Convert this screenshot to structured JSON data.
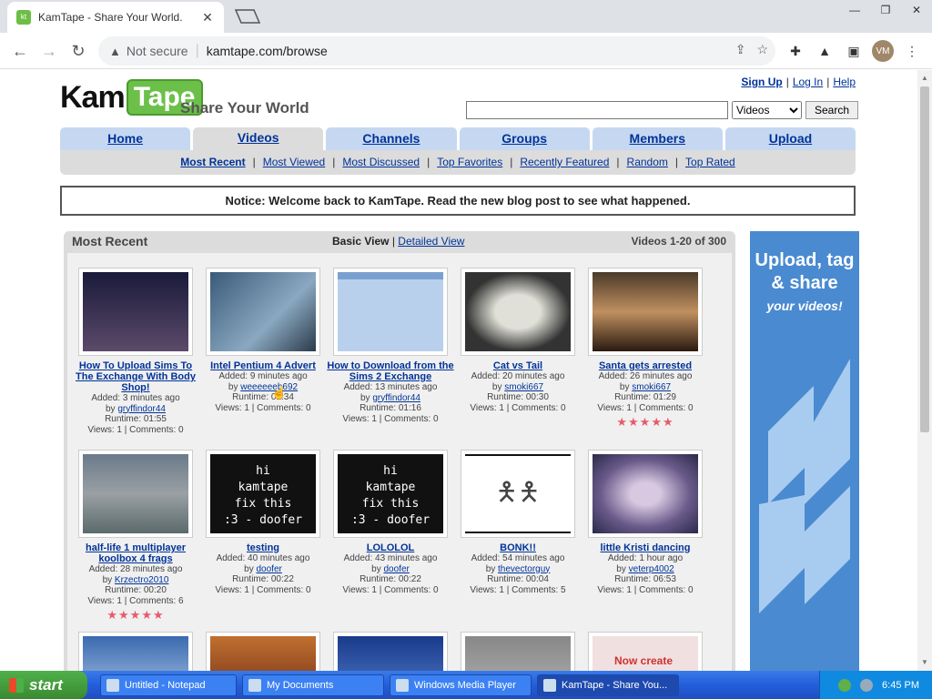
{
  "browser": {
    "tab_title": "KamTape - Share Your World.",
    "tab_favicon_text": "kt",
    "security_label": "Not secure",
    "url": "kamtape.com/browse",
    "profile_initials": "VM"
  },
  "header": {
    "logo_kam": "Kam",
    "logo_tape": "Tape",
    "slogan": "Share Your World",
    "signup": "Sign Up",
    "login": "Log In",
    "help": "Help",
    "sep": "|",
    "search_value": "",
    "search_option": "Videos",
    "search_button": "Search"
  },
  "nav": {
    "tabs": [
      "Home",
      "Videos",
      "Channels",
      "Groups",
      "Members",
      "Upload"
    ],
    "active": "Videos",
    "sub": [
      "Most Recent",
      "Most Viewed",
      "Most Discussed",
      "Top Favorites",
      "Recently Featured",
      "Random",
      "Top Rated"
    ]
  },
  "notice": "Notice: Welcome back to KamTape. Read the new blog post to see what happened.",
  "panel": {
    "title": "Most Recent",
    "basic_view": "Basic View",
    "pipe": "|",
    "detailed_view": "Detailed View",
    "count": "Videos 1-20 of 300"
  },
  "videos": [
    {
      "title": "How To Upload Sims To The Exchange With Body Shop!",
      "added": "Added: 3 minutes ago",
      "by": "by",
      "user": "gryffindor44",
      "runtime": "Runtime: 01:55",
      "stats": "Views: 1 | Comments: 0",
      "stars": ""
    },
    {
      "title": "Intel Pentium 4 Advert",
      "added": "Added: 9 minutes ago",
      "by": "by",
      "user": "weeeeeeb692",
      "runtime": "Runtime: 01:34",
      "stats": "Views: 1 | Comments: 0",
      "stars": ""
    },
    {
      "title": "How to Download from the Sims 2 Exchange",
      "added": "Added: 13 minutes ago",
      "by": "by",
      "user": "gryffindor44",
      "runtime": "Runtime: 01:16",
      "stats": "Views: 1 | Comments: 0",
      "stars": ""
    },
    {
      "title": "Cat vs Tail",
      "added": "Added: 20 minutes ago",
      "by": "by",
      "user": "smoki667",
      "runtime": "Runtime: 00:30",
      "stats": "Views: 1 | Comments: 0",
      "stars": ""
    },
    {
      "title": "Santa gets arrested",
      "added": "Added: 26 minutes ago",
      "by": "by",
      "user": "smoki667",
      "runtime": "Runtime: 01:29",
      "stats": "Views: 1 | Comments: 0",
      "stars": "★★★★★"
    },
    {
      "title": "half-life 1 multiplayer koolbox 4 frags",
      "added": "Added: 28 minutes ago",
      "by": "by",
      "user": "Krzectro2010",
      "runtime": "Runtime: 00:20",
      "stats": "Views: 1 | Comments: 6",
      "stars": "★★★★★"
    },
    {
      "title": "testing",
      "added": "Added: 40 minutes ago",
      "by": "by",
      "user": "doofer",
      "runtime": "Runtime: 00:22",
      "stats": "Views: 1 | Comments: 0",
      "stars": ""
    },
    {
      "title": "LOLOLOL",
      "added": "Added: 43 minutes ago",
      "by": "by",
      "user": "doofer",
      "runtime": "Runtime: 00:22",
      "stats": "Views: 1 | Comments: 0",
      "stars": ""
    },
    {
      "title": "BONK!!",
      "added": "Added: 54 minutes ago",
      "by": "by",
      "user": "thevectorguy",
      "runtime": "Runtime: 00:04",
      "stats": "Views: 1 | Comments: 5",
      "stars": ""
    },
    {
      "title": "little Kristi dancing",
      "added": "Added: 1 hour ago",
      "by": "by",
      "user": "veterp4002",
      "runtime": "Runtime: 06:53",
      "stats": "Views: 1 | Comments: 0",
      "stars": ""
    }
  ],
  "thumb_text": {
    "hi": "hi",
    "kamtape": "kamtape",
    "fix": "fix this",
    "doofer": ":3 - doofer",
    "now_create": "Now create"
  },
  "ad": {
    "line1": "Upload, tag & share",
    "line2": "your videos!"
  },
  "taskbar": {
    "start": "start",
    "tasks": [
      "Untitled - Notepad",
      "My Documents",
      "Windows Media Player",
      "KamTape - Share You..."
    ],
    "clock": "6:45 PM"
  }
}
